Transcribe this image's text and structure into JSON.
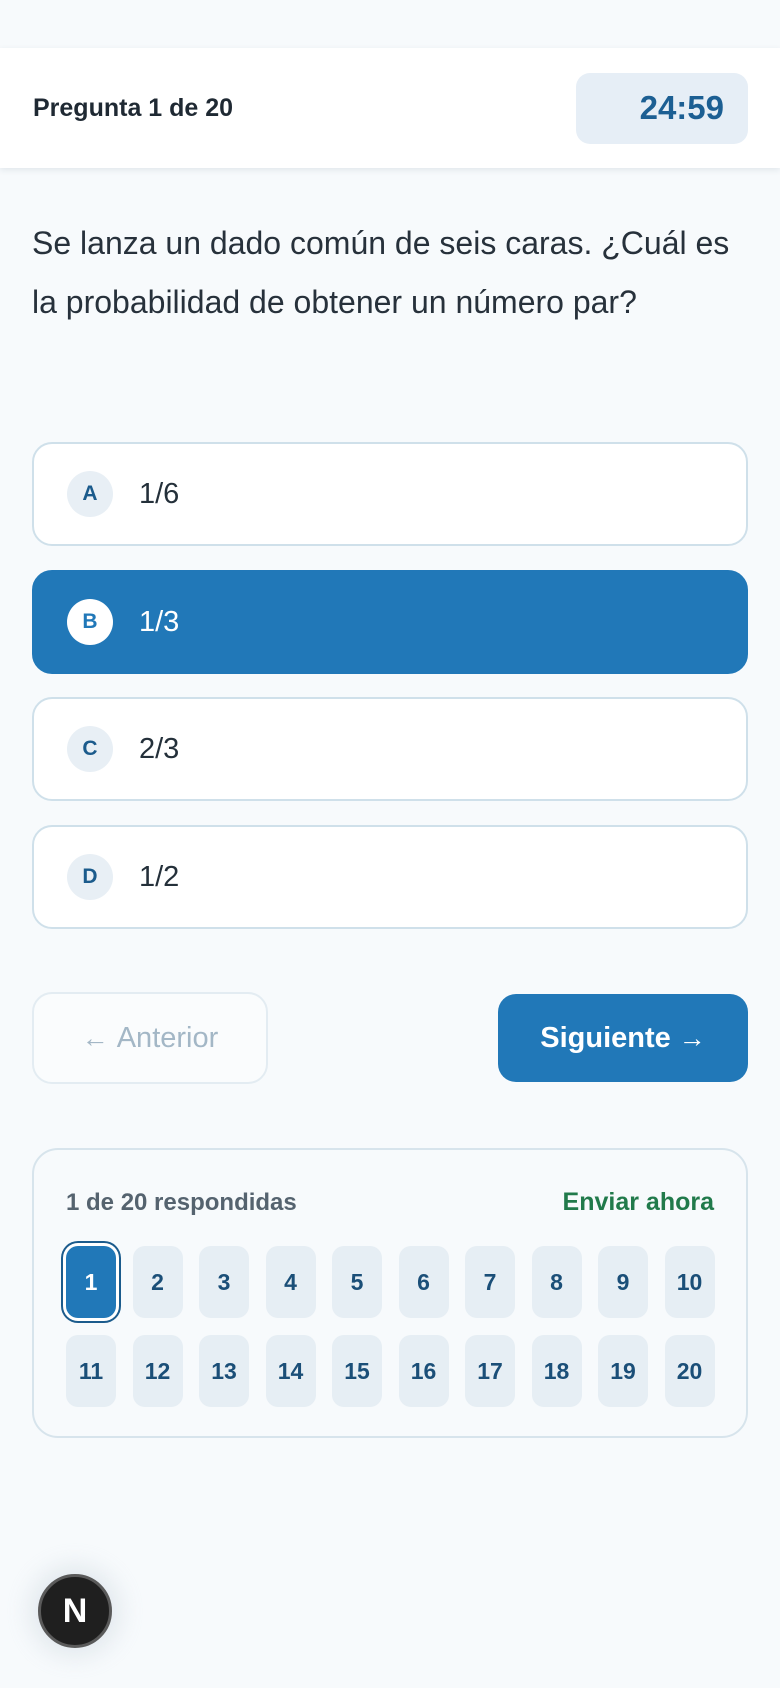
{
  "header": {
    "progress_label": "Pregunta 1 de 20",
    "timer": "24:59"
  },
  "question": {
    "text": "Se lanza un dado común de seis caras. ¿Cuál es la probabilidad de obtener un número par?"
  },
  "options": [
    {
      "letter": "A",
      "text": "1/6",
      "selected": false
    },
    {
      "letter": "B",
      "text": "1/3",
      "selected": true
    },
    {
      "letter": "C",
      "text": "2/3",
      "selected": false
    },
    {
      "letter": "D",
      "text": "1/2",
      "selected": false
    }
  ],
  "nav": {
    "prev_label": "Anterior",
    "prev_icon": "arrow-left-icon",
    "next_label": "Siguiente",
    "next_icon": "arrow-right-icon"
  },
  "panel": {
    "answered": "1 de 20 respondidas",
    "submit_label": "Enviar ahora",
    "submit_color": "#217a4b",
    "current_question": 1,
    "numbers": [
      "1",
      "2",
      "3",
      "4",
      "5",
      "6",
      "7",
      "8",
      "9",
      "10",
      "11",
      "12",
      "13",
      "14",
      "15",
      "16",
      "17",
      "18",
      "19",
      "20"
    ]
  },
  "dev_badge": {
    "letter": "N"
  },
  "colors": {
    "accent": "#2178b8",
    "background": "#f7fafc"
  }
}
